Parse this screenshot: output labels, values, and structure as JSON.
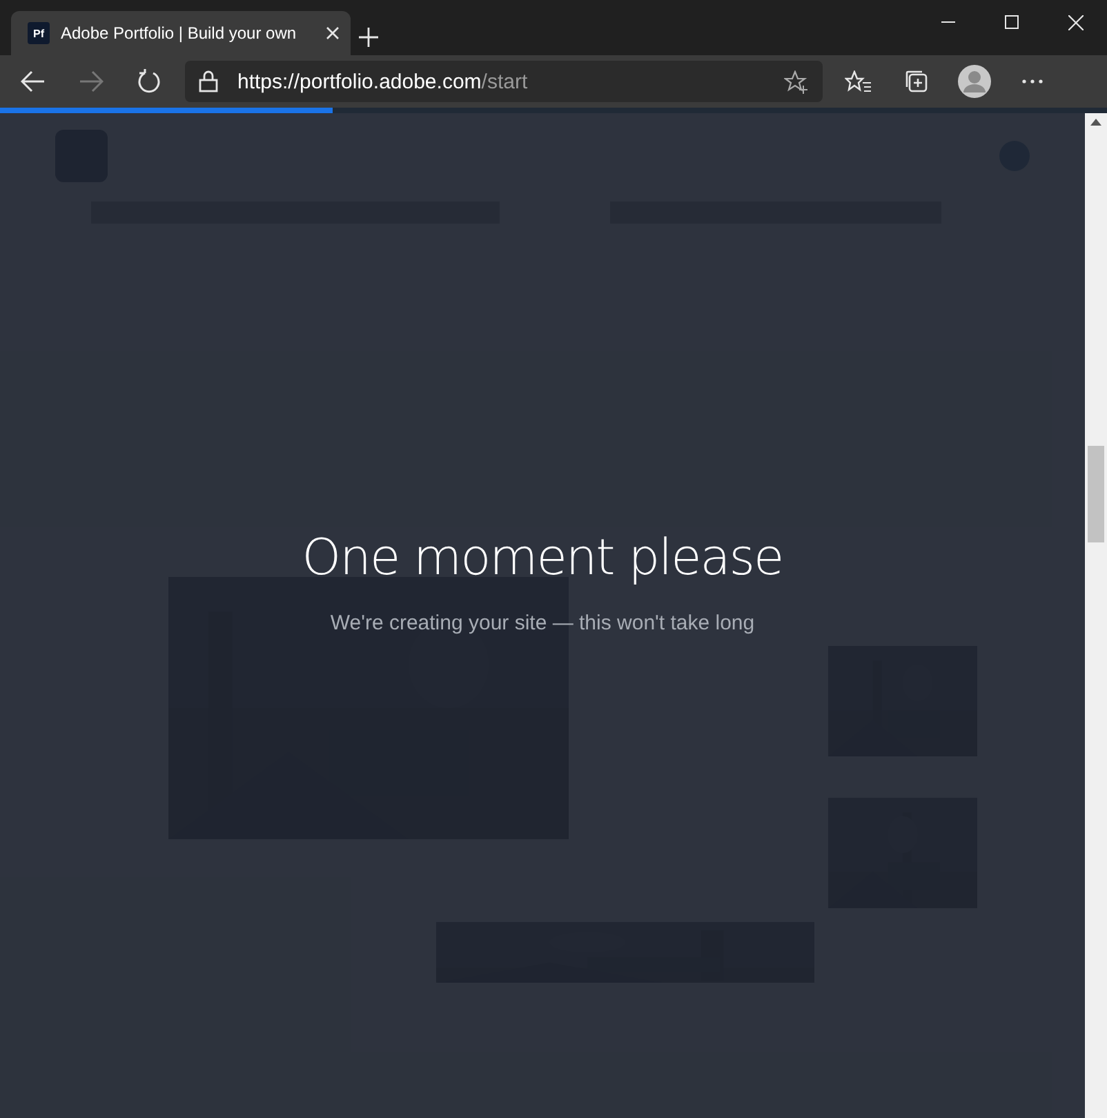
{
  "browser": {
    "tab": {
      "title": "Adobe Portfolio | Build your own",
      "favicon": "Pf",
      "selected": true
    },
    "address": {
      "scheme": "https://",
      "host": "portfolio.adobe.com",
      "path": "/start"
    },
    "loading": {
      "level": 0.3
    }
  },
  "overlay": {
    "title": "One moment please",
    "subtitle": "We're creating your site — this won't take long"
  }
}
